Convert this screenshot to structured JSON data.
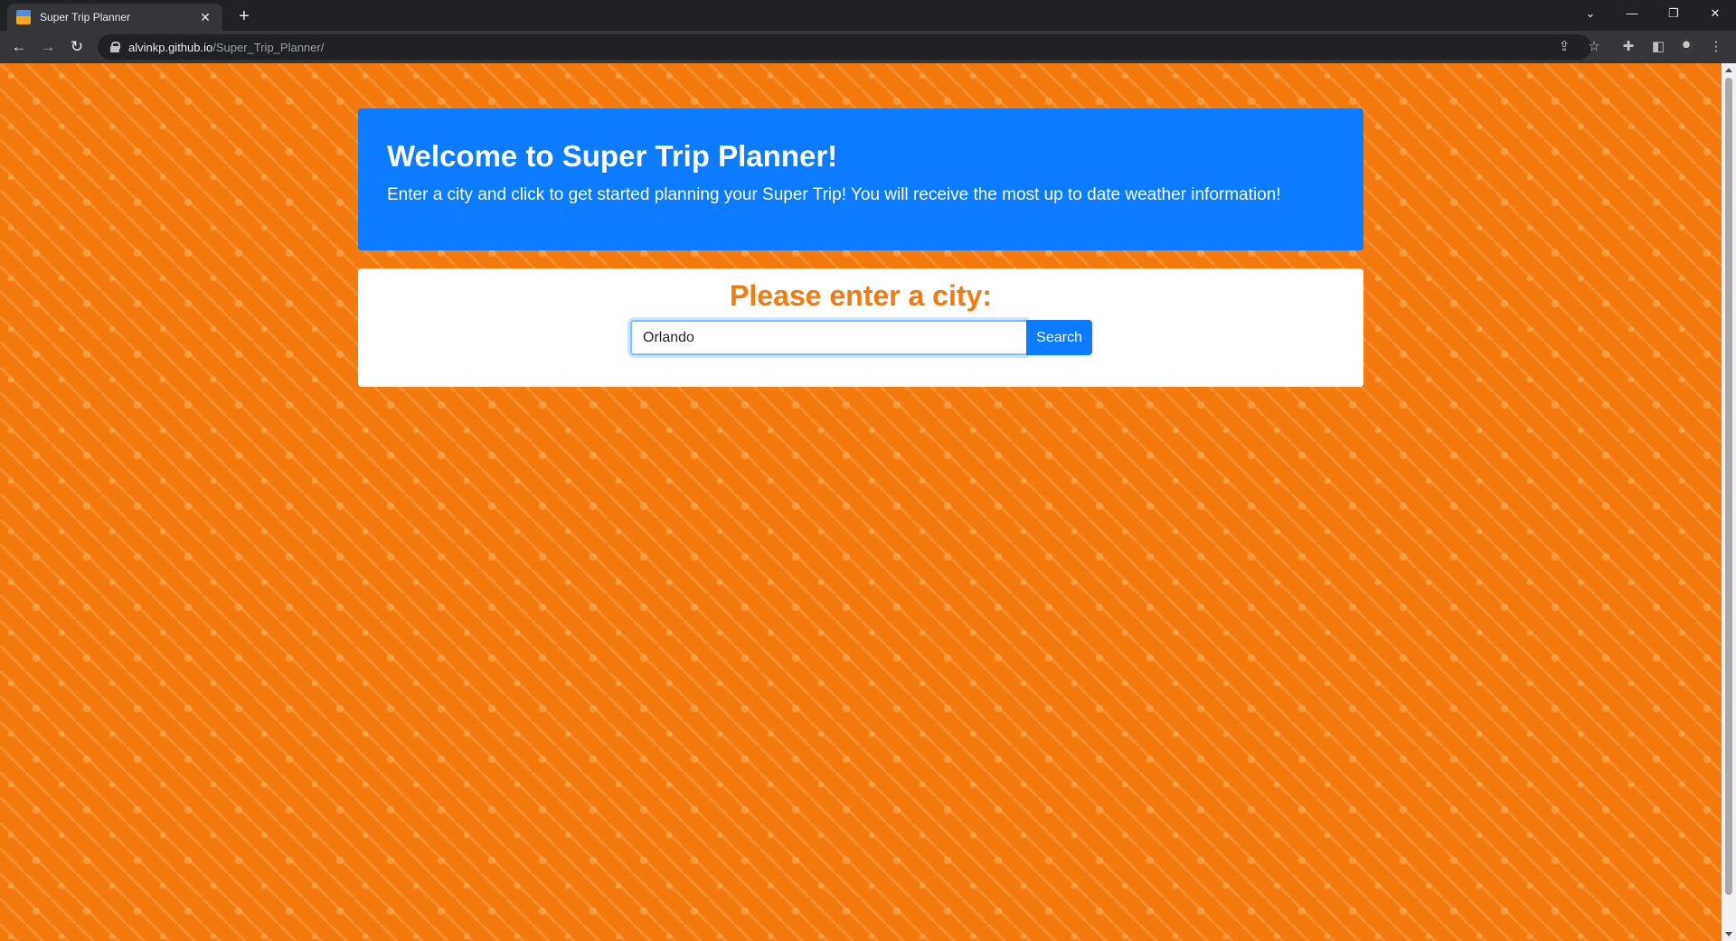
{
  "browser": {
    "tab_title": "Super Trip Planner",
    "url_host": "alvinkp.github.io",
    "url_path": "/Super_Trip_Planner/",
    "icons": [
      "back-icon",
      "forward-icon",
      "reload-icon",
      "share-icon",
      "bookmark-star-icon",
      "extensions-icon",
      "side-panel-icon",
      "profile-avatar",
      "menu-icon"
    ]
  },
  "page": {
    "jumbotron": {
      "title": "Welcome to Super Trip Planner!",
      "lead": "Enter a city and click to get started planning your Super Trip! You will receive the most up to date weather information!"
    },
    "search": {
      "heading": "Please enter a city:",
      "input_value": "Orlando",
      "button_label": "Search"
    }
  },
  "colors": {
    "background": "#f47a0d",
    "jumbotron": "#0b7bff",
    "heading": "#f47a0d",
    "button": "#0b7bff"
  }
}
